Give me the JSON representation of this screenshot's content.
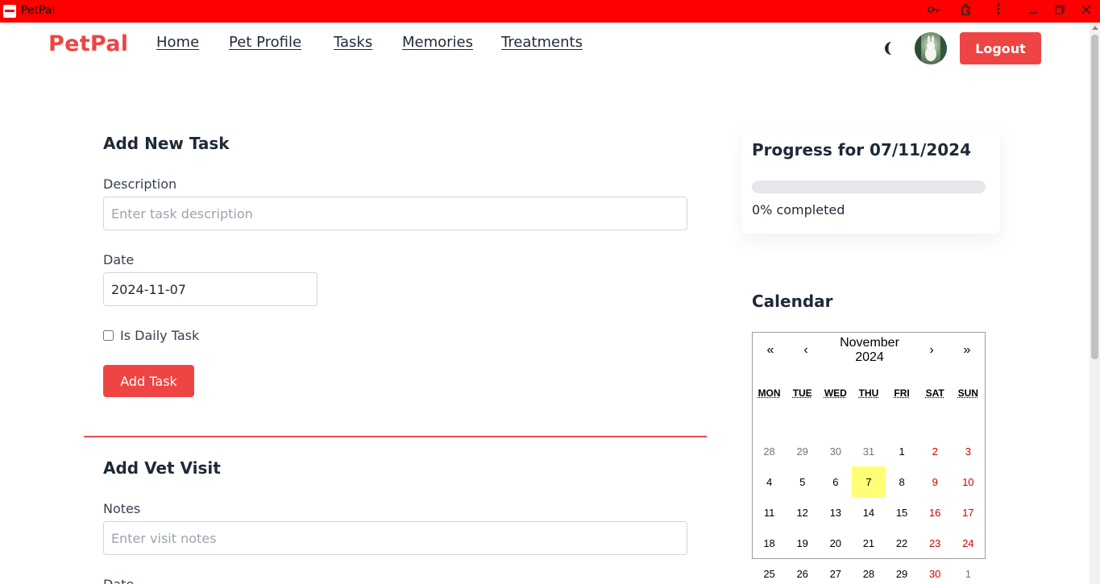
{
  "window": {
    "title": "PetPal"
  },
  "nav": {
    "brand": "PetPal",
    "links": [
      "Home",
      "Pet Profile",
      "Tasks",
      "Memories",
      "Treatments"
    ],
    "logout": "Logout"
  },
  "task_form": {
    "heading": "Add New Task",
    "description_label": "Description",
    "description_placeholder": "Enter task description",
    "date_label": "Date",
    "date_value": "2024-11-07",
    "daily_label": "Is Daily Task",
    "daily_checked": false,
    "submit": "Add Task"
  },
  "vet_form": {
    "heading": "Add Vet Visit",
    "notes_label": "Notes",
    "notes_placeholder": "Enter visit notes",
    "date_label": "Date"
  },
  "progress": {
    "heading": "Progress for 07/11/2024",
    "percent": 0,
    "status": "0% completed"
  },
  "calendar": {
    "heading": "Calendar",
    "prev2": "«",
    "prev": "‹",
    "month_label": "November 2024",
    "next": "›",
    "next2": "»",
    "weekdays": [
      "MON",
      "TUE",
      "WED",
      "THU",
      "FRI",
      "SAT",
      "SUN"
    ],
    "days": [
      {
        "n": "28",
        "neighbor": true
      },
      {
        "n": "29",
        "neighbor": true
      },
      {
        "n": "30",
        "neighbor": true
      },
      {
        "n": "31",
        "neighbor": true
      },
      {
        "n": "1"
      },
      {
        "n": "2"
      },
      {
        "n": "3"
      },
      {
        "n": "4"
      },
      {
        "n": "5"
      },
      {
        "n": "6"
      },
      {
        "n": "7",
        "today": true
      },
      {
        "n": "8"
      },
      {
        "n": "9"
      },
      {
        "n": "10"
      },
      {
        "n": "11"
      },
      {
        "n": "12"
      },
      {
        "n": "13"
      },
      {
        "n": "14"
      },
      {
        "n": "15"
      },
      {
        "n": "16"
      },
      {
        "n": "17"
      },
      {
        "n": "18"
      },
      {
        "n": "19"
      },
      {
        "n": "20"
      },
      {
        "n": "21"
      },
      {
        "n": "22"
      },
      {
        "n": "23"
      },
      {
        "n": "24"
      },
      {
        "n": "25"
      },
      {
        "n": "26"
      },
      {
        "n": "27"
      },
      {
        "n": "28"
      },
      {
        "n": "29"
      },
      {
        "n": "30"
      },
      {
        "n": "1",
        "neighbor": true
      }
    ]
  },
  "colors": {
    "accent": "#ef4444",
    "titlebar": "#ff0000",
    "today": "#ffff76",
    "weekend": "#d10000"
  }
}
